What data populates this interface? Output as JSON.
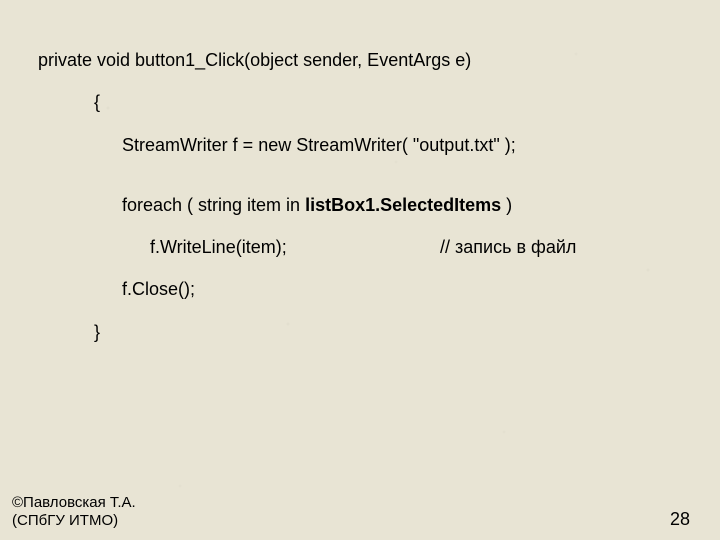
{
  "code": {
    "sig_a": "private void button1_Click(object sender, EventArgs e)",
    "open": "{",
    "l1": "StreamWriter f = new StreamWriter( \"output.txt\" );",
    "l2_a": "foreach ( string item in ",
    "l2_b": "listBox1.SelectedItems",
    "l2_c": " )",
    "l3_a": "f.WriteLine(item);",
    "l3_b": "// запись в файл",
    "l4": "f.Close();",
    "close": "}"
  },
  "footer": {
    "author": "©Павловская Т.А.",
    "org": "(СПбГУ ИТМО)",
    "page": "28"
  }
}
